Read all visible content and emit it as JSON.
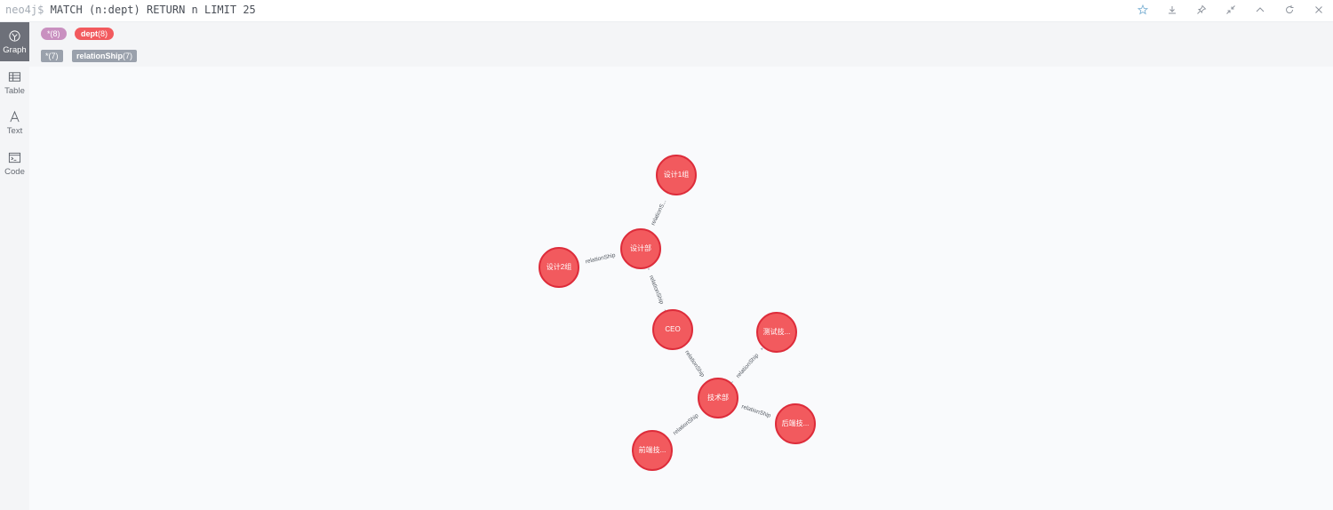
{
  "query": {
    "prompt": "neo4j$",
    "text": "MATCH (n:dept) RETURN n LIMIT 25"
  },
  "toolbar_icons": [
    "star-icon",
    "download-icon",
    "pin-icon",
    "collapse-icon",
    "chevron-up-icon",
    "refresh-icon",
    "close-icon"
  ],
  "sidebar": {
    "items": [
      {
        "label": "Graph",
        "icon": "graph-icon",
        "active": true
      },
      {
        "label": "Table",
        "icon": "table-icon",
        "active": false
      },
      {
        "label": "Text",
        "icon": "text-icon",
        "active": false
      },
      {
        "label": "Code",
        "icon": "code-icon",
        "active": false
      }
    ]
  },
  "legend": {
    "node_all": "*(8)",
    "node_label_name": "dept",
    "node_label_count": "(8)",
    "rel_all": "*(7)",
    "rel_type_name": "relationShip",
    "rel_type_count": "(7)"
  },
  "colors": {
    "node_fill": "#f25a5e",
    "node_stroke": "#dd2c3a",
    "all_pill": "#c990c0",
    "rel_tag": "#9aa1ac",
    "edge": "#a5abb6"
  },
  "graph": {
    "nodes": [
      {
        "id": "sj1",
        "label": "设计1组"
      },
      {
        "id": "sjb",
        "label": "设计部"
      },
      {
        "id": "sj2",
        "label": "设计2组"
      },
      {
        "id": "ceo",
        "label": "CEO"
      },
      {
        "id": "cs",
        "label": "测试技..."
      },
      {
        "id": "js",
        "label": "技术部"
      },
      {
        "id": "hd",
        "label": "后端技..."
      },
      {
        "id": "qd",
        "label": "前端技..."
      }
    ],
    "edges": [
      {
        "from": "sjb",
        "to": "sj1",
        "label": "relationS..."
      },
      {
        "from": "sjb",
        "to": "sj2",
        "label": "relationShip"
      },
      {
        "from": "ceo",
        "to": "sjb",
        "label": "relationShip"
      },
      {
        "from": "ceo",
        "to": "js",
        "label": "relationShip"
      },
      {
        "from": "js",
        "to": "cs",
        "label": "relationShip"
      },
      {
        "from": "js",
        "to": "hd",
        "label": "relationShip"
      },
      {
        "from": "js",
        "to": "qd",
        "label": "relationShip"
      }
    ]
  }
}
